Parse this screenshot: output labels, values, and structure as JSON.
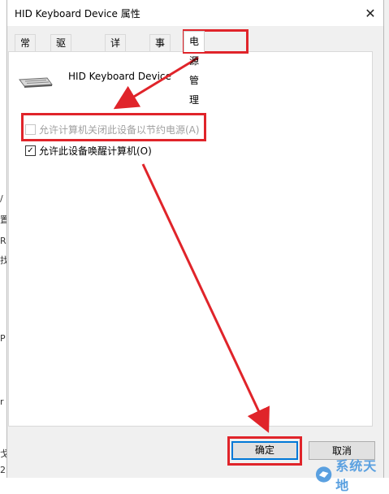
{
  "window": {
    "title": "HID Keyboard Device 属性"
  },
  "tabs": [
    {
      "label": "常规"
    },
    {
      "label": "驱动程序"
    },
    {
      "label": "详细信息"
    },
    {
      "label": "事件"
    },
    {
      "label": "电源管理",
      "active": true
    }
  ],
  "device": {
    "name": "HID Keyboard Device",
    "icon": "keyboard-icon"
  },
  "options": [
    {
      "label": "允许计算机关闭此设备以节约电源(A)",
      "checked": false,
      "disabled": true
    },
    {
      "label": "允许此设备唤醒计算机(O)",
      "checked": true,
      "disabled": false
    }
  ],
  "buttons": {
    "ok": "确定",
    "cancel": "取消"
  },
  "watermark": {
    "text": "系统天地"
  },
  "background_fragments": [
    "/",
    "置",
    "R",
    "找",
    "P",
    "r",
    "戈",
    "2"
  ],
  "colors": {
    "highlight": "#e0242a",
    "focus": "#0078d7",
    "watermark": "#5aa0e0"
  }
}
